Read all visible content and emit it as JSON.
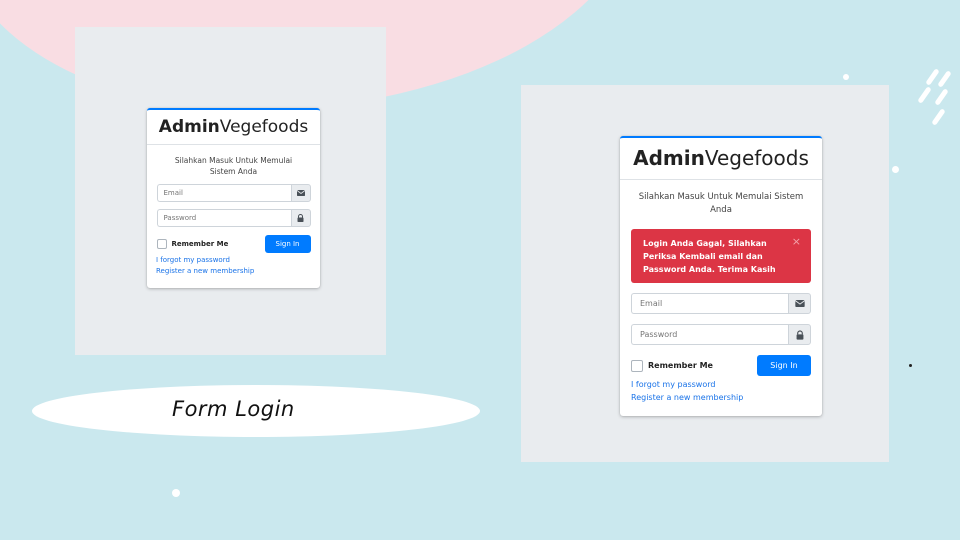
{
  "caption": "Form Login",
  "brand": {
    "bold": "Admin",
    "regular": "Vegefoods"
  },
  "login_box_msg": "Silahkan Masuk Untuk Memulai Sistem Anda",
  "fields": {
    "email_placeholder": "Email",
    "password_placeholder": "Password"
  },
  "remember_label": "Remember Me",
  "sign_in_label": "Sign In",
  "forgot_link": "I forgot my password",
  "register_link": "Register a new membership",
  "alert": {
    "message": "Login Anda Gagal, Silahkan Periksa Kembali email dan Password Anda. Terima Kasih",
    "close": "×"
  },
  "icons": {
    "email": "envelope-icon",
    "password": "lock-icon"
  },
  "colors": {
    "primary": "#007bff",
    "danger": "#dc3545",
    "background": "#cae8ee",
    "panel": "#e9ecef"
  }
}
